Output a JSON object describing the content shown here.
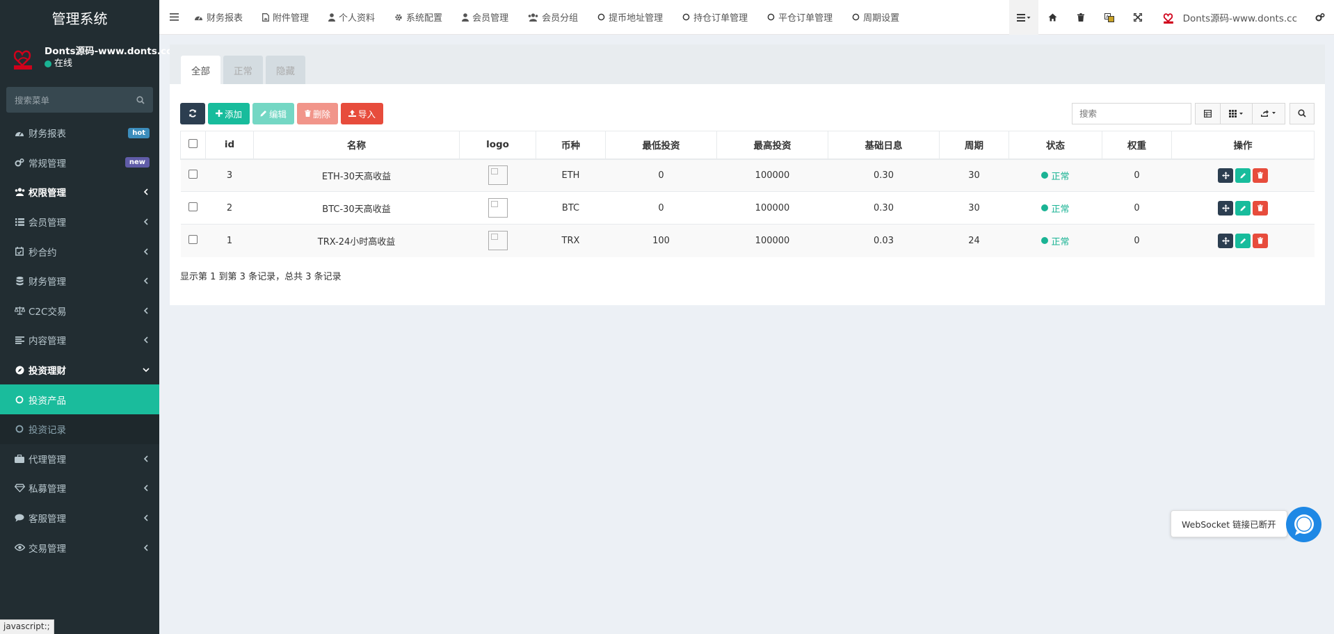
{
  "app_title": "管理系统",
  "user": {
    "name": "Donts源码-www.donts.cc",
    "status": "在线"
  },
  "sidebar": {
    "search_placeholder": "搜索菜单",
    "items": [
      {
        "label": "财务报表",
        "icon": "dashboard-icon",
        "badge": "hot",
        "badge_color": "#3c8dbc"
      },
      {
        "label": "常规管理",
        "icon": "cogs-icon",
        "badge": "new",
        "badge_color": "#605ca8"
      },
      {
        "label": "权限管理",
        "icon": "group-icon"
      },
      {
        "label": "会员管理",
        "icon": "list-icon"
      },
      {
        "label": "秒合约",
        "icon": "calendar-icon"
      },
      {
        "label": "财务管理",
        "icon": "database-icon"
      },
      {
        "label": "C2C交易",
        "icon": "balance-scale-icon"
      },
      {
        "label": "内容管理",
        "icon": "align-left-icon"
      },
      {
        "label": "投资理财",
        "icon": "compass-icon"
      },
      {
        "label": "投资产品",
        "icon": "circle-icon"
      },
      {
        "label": "投资记录",
        "icon": "circle-icon"
      },
      {
        "label": "代理管理",
        "icon": "suitcase-icon"
      },
      {
        "label": "私募管理",
        "icon": "diamond-icon"
      },
      {
        "label": "客服管理",
        "icon": "comment-icon"
      },
      {
        "label": "交易管理",
        "icon": "eye-icon"
      }
    ]
  },
  "topnav": {
    "links": [
      {
        "label": "财务报表",
        "icon": "dashboard-icon"
      },
      {
        "label": "附件管理",
        "icon": "file-image-icon"
      },
      {
        "label": "个人资料",
        "icon": "user-icon"
      },
      {
        "label": "系统配置",
        "icon": "cog-icon"
      },
      {
        "label": "会员管理",
        "icon": "user-icon"
      },
      {
        "label": "会员分组",
        "icon": "users-icon"
      },
      {
        "label": "提币地址管理",
        "icon": "circle-icon"
      },
      {
        "label": "持仓订单管理",
        "icon": "circle-icon"
      },
      {
        "label": "平仓订单管理",
        "icon": "circle-icon"
      },
      {
        "label": "周期设置",
        "icon": "circle-icon"
      }
    ],
    "brand": "Donts源码-www.donts.cc"
  },
  "tabs": [
    {
      "label": "全部",
      "active": true
    },
    {
      "label": "正常",
      "active": false
    },
    {
      "label": "隐藏",
      "active": false
    }
  ],
  "toolbar": {
    "add": "添加",
    "edit": "编辑",
    "delete": "删除",
    "import": "导入",
    "search_placeholder": "搜索"
  },
  "table": {
    "headers": [
      "id",
      "名称",
      "logo",
      "币种",
      "最低投资",
      "最高投资",
      "基础日息",
      "周期",
      "状态",
      "权重",
      "操作"
    ],
    "rows": [
      {
        "id": "3",
        "name": "ETH-30天高收益",
        "coin": "ETH",
        "min": "0",
        "max": "100000",
        "rate": "0.30",
        "period": "30",
        "status": "正常",
        "weight": "0"
      },
      {
        "id": "2",
        "name": "BTC-30天高收益",
        "coin": "BTC",
        "min": "0",
        "max": "100000",
        "rate": "0.30",
        "period": "30",
        "status": "正常",
        "weight": "0"
      },
      {
        "id": "1",
        "name": "TRX-24小时高收益",
        "coin": "TRX",
        "min": "100",
        "max": "100000",
        "rate": "0.03",
        "period": "24",
        "status": "正常",
        "weight": "0"
      }
    ],
    "summary": "显示第 1 到第 3 条记录，总共 3 条记录"
  },
  "websocket_tip": "WebSocket 链接已断开",
  "statusbar": "javascript:;",
  "colors": {
    "accent": "#1abc9c",
    "sidebar_bg": "#222d32",
    "success": "#1ab394",
    "danger": "#e74c3c",
    "dark": "#2c3e50"
  }
}
